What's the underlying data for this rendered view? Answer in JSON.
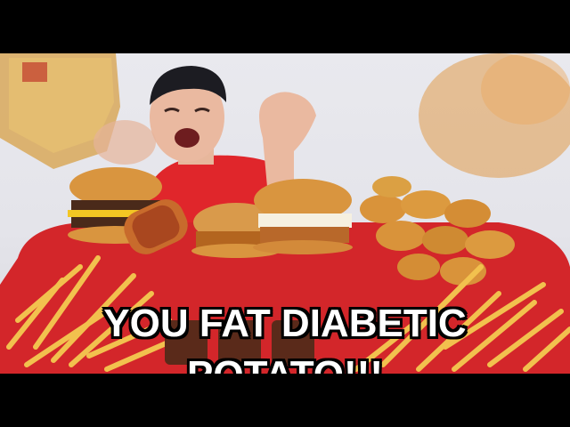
{
  "caption": {
    "line1": "YOU FAT DIABETIC",
    "line2": "POTATO!!!"
  },
  "colors": {
    "shirt": "#e0262b",
    "tray": "#d3262a",
    "fries": "#f2c14e",
    "nuggets": "#d9933a",
    "bun": "#d9953f",
    "caption_text": "#ffffff",
    "caption_outline": "#000000"
  }
}
